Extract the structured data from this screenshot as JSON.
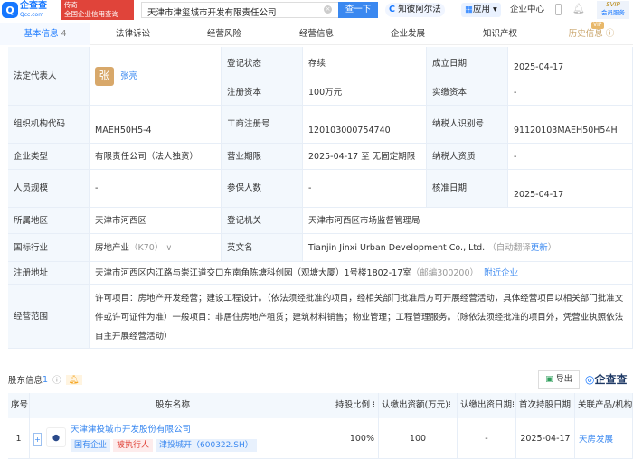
{
  "header": {
    "logo_text": "企查查",
    "logo_sub": "Qcc.com",
    "slogan_1": "传奇",
    "slogan_2": "全国企业信用查询",
    "search_value": "天津市津玺城市开发有限责任公司",
    "search_button": "查一下",
    "ai_label": "知彼阿尔法",
    "apps_label": "应用",
    "enterprise_center": "企业中心",
    "vip_top": "SVIP",
    "vip_bottom": "会员服务"
  },
  "tabs": [
    {
      "label": "基本信息",
      "count": "4"
    },
    {
      "label": "法律诉讼"
    },
    {
      "label": "经营风险"
    },
    {
      "label": "经营信息"
    },
    {
      "label": "企业发展"
    },
    {
      "label": "知识产权"
    },
    {
      "label": "历史信息",
      "badge": "VIP"
    }
  ],
  "info": {
    "legal_rep_label": "法定代表人",
    "legal_rep_avatar": "张",
    "legal_rep": "张亮",
    "reg_status_label": "登记状态",
    "reg_status": "存续",
    "found_date_label": "成立日期",
    "found_date": "2025-04-17",
    "reg_capital_label": "注册资本",
    "reg_capital": "100万元",
    "paid_capital_label": "实缴资本",
    "paid_capital": "-",
    "org_code_label": "组织机构代码",
    "org_code": "MAEH50H5-4",
    "biz_reg_no_label": "工商注册号",
    "biz_reg_no": "120103000754740",
    "tax_id_label": "纳税人识别号",
    "tax_id": "91120103MAEH50H54H",
    "type_label": "企业类型",
    "type": "有限责任公司（法人独资）",
    "term_label": "营业期限",
    "term": "2025-04-17 至 无固定期限",
    "tax_qual_label": "纳税人资质",
    "tax_qual": "-",
    "staff_label": "人员规模",
    "staff": "-",
    "insured_label": "参保人数",
    "insured": "-",
    "approve_label": "核准日期",
    "approve": "2025-04-17",
    "region_label": "所属地区",
    "region": "天津市河西区",
    "authority_label": "登记机关",
    "authority": "天津市河西区市场监督管理局",
    "industry_label": "国标行业",
    "industry": "房地产业",
    "industry_code": "（K70）",
    "en_name_label": "英文名",
    "en_name": "Tianjin Jinxi Urban Development Co., Ltd.",
    "auto_translate": "（自动翻译",
    "update": "更新",
    "close_paren": "）",
    "address_label": "注册地址",
    "address": "天津市河西区内江路与崇江道交口东南角陈塘科创园（观塘大厦）1号楼1802-17室",
    "postcode": "（邮编300200）",
    "nearby": "附近企业",
    "scope_label": "经营范围",
    "scope": "许可项目：房地产开发经营；建设工程设计。（依法须经批准的项目，经相关部门批准后方可开展经营活动，具体经营项目以相关部门批准文件或许可证件为准）一般项目：非居住房地产租赁；建筑材料销售；物业管理；工程管理服务。（除依法须经批准的项目外，凭营业执照依法自主开展经营活动）"
  },
  "shareholders": {
    "title": "股东信息",
    "count": "1",
    "export": "导出",
    "brand": "企查查",
    "columns": [
      "序号",
      "股东名称",
      "持股比例",
      "认缴出资额(万元)",
      "认缴出资日期",
      "首次持股日期",
      "关联产品/机构"
    ],
    "rows": [
      {
        "no": "1",
        "name": "天津津投城市开发股份有限公司",
        "tags": [
          "国有企业",
          "被执行人",
          "津投城开（600322.SH）"
        ],
        "ratio": "100%",
        "amount": "100",
        "sub_date": "-",
        "first_date": "2025-04-17",
        "related": "天房发展"
      }
    ]
  }
}
